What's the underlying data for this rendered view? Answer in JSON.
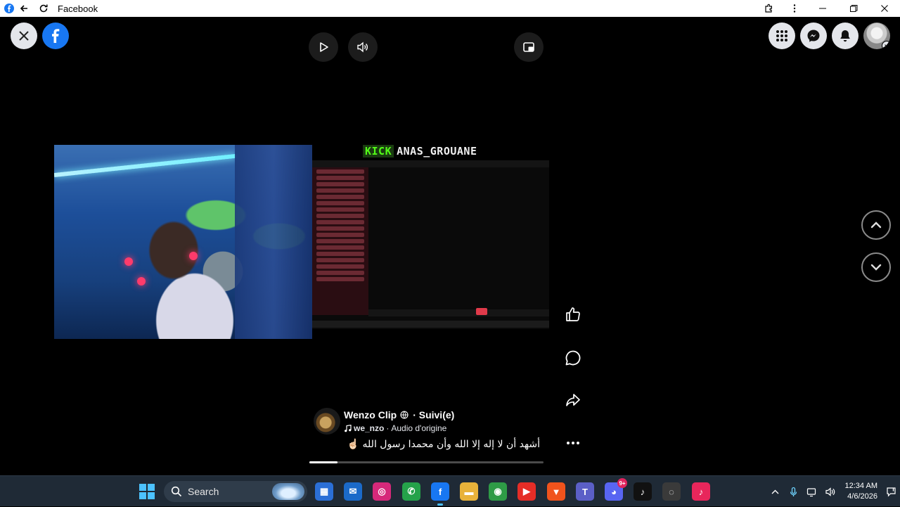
{
  "window": {
    "title": "Facebook"
  },
  "stream": {
    "platform_tag": "KICK",
    "channel": "ANAS_GROUANE"
  },
  "post": {
    "author": "Wenzo Clip",
    "follow_status": "· Suivi(e)",
    "audio_user": "we_nzo",
    "audio_separator": "·",
    "audio_label": "Audio d'origine",
    "caption": "أشهد أن لا إله إلا الله وأن محمدا رسول الله ☝🏻"
  },
  "playback": {
    "progress": 0.12
  },
  "taskbar": {
    "search_label": "Search",
    "discord_badge": "9+",
    "time": "12:34 AM",
    "date": "4/6/2026",
    "icons": [
      {
        "name": "store-icon",
        "color": "#2b6fd6",
        "glyph": "▦"
      },
      {
        "name": "outlook-icon",
        "color": "#1b6ac9",
        "glyph": "✉"
      },
      {
        "name": "instagram-icon",
        "color": "#d6297a",
        "glyph": "◎"
      },
      {
        "name": "whatsapp-icon",
        "color": "#25a24a",
        "glyph": "✆"
      },
      {
        "name": "facebook-icon",
        "color": "#1877f2",
        "glyph": "f"
      },
      {
        "name": "file-explorer-icon",
        "color": "#e8b23a",
        "glyph": "▬"
      },
      {
        "name": "chrome-icon",
        "color": "#2e9b46",
        "glyph": "◉"
      },
      {
        "name": "youtube-icon",
        "color": "#e52d27",
        "glyph": "▶"
      },
      {
        "name": "brave-icon",
        "color": "#f0531c",
        "glyph": "▼"
      },
      {
        "name": "teams-icon",
        "color": "#5b5fc7",
        "glyph": "T"
      },
      {
        "name": "discord-icon",
        "color": "#5865f2",
        "glyph": "◕"
      },
      {
        "name": "tiktok-icon",
        "color": "#111111",
        "glyph": "♪"
      },
      {
        "name": "app-icon",
        "color": "#3a3a3a",
        "glyph": "◌"
      },
      {
        "name": "tiktok-lite-icon",
        "color": "#e8265b",
        "glyph": "♪"
      }
    ]
  },
  "colors": {
    "facebook_blue": "#1877f2",
    "kick_green": "#53fc18",
    "taskbar_bg": "#1f2a36"
  }
}
